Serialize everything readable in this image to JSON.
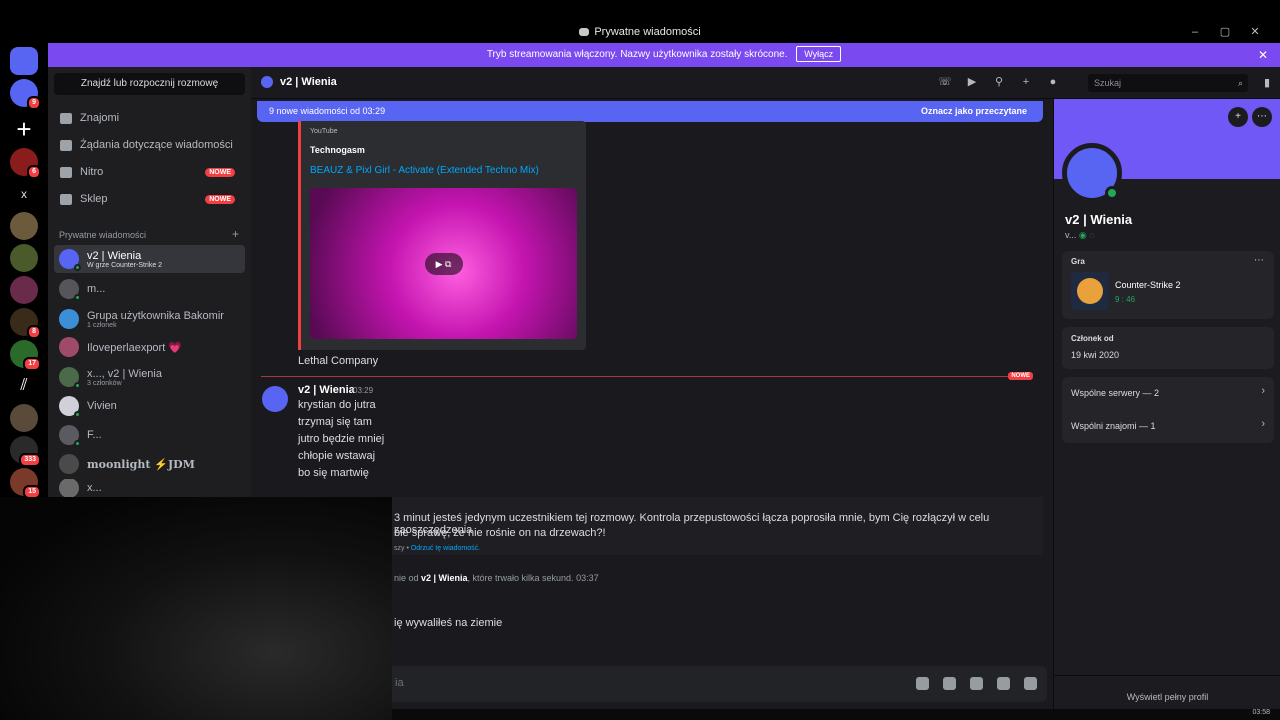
{
  "window": {
    "title": "Prywatne wiadomości",
    "controls": [
      "–",
      "▢",
      "✕"
    ]
  },
  "banner": {
    "text": "Tryb streamowania włączony. Nazwy użytkownika zostały skrócone.",
    "button": "Wyłącz",
    "close": "✕"
  },
  "rail": {
    "badges": [
      "9",
      "6",
      "8",
      "17",
      "333",
      "15"
    ],
    "x_label": "x"
  },
  "sidebar": {
    "search_placeholder": "Znajdź lub rozpocznij rozmowę",
    "nav": [
      {
        "label": "Znajomi"
      },
      {
        "label": "Żądania dotyczące wiadomości"
      },
      {
        "label": "Nitro",
        "badge": "NOWE"
      },
      {
        "label": "Sklep",
        "badge": "NOWE"
      }
    ],
    "section_label": "Prywatne wiadomości",
    "section_add": "+",
    "dms": [
      {
        "name": "v2 | Wienia",
        "sub": "W grze Counter-Strike 2",
        "active": true
      },
      {
        "name": "m...",
        "sub": ""
      },
      {
        "name": "Grupa użytkownika Bakomir",
        "sub": "1 członek"
      },
      {
        "name": "Iloveperlaexport 💗",
        "sub": ""
      },
      {
        "name": "x..., v2 | Wienia",
        "sub": "3 członków"
      },
      {
        "name": "Vivien",
        "sub": ""
      },
      {
        "name": "F...",
        "sub": ""
      },
      {
        "name": "moonlight ⚡JDM",
        "sub": ""
      },
      {
        "name": "x...",
        "sub": ""
      }
    ]
  },
  "header": {
    "title": "v2 | Wienia",
    "search_placeholder": "Szukaj"
  },
  "chat": {
    "new_messages": "9 nowe wiadomości od 03:29",
    "mark_read": "Oznacz jako przeczytane",
    "embed": {
      "source": "YouTube",
      "author": "Technogasm",
      "title": "BEAUZ & Pixl Girl - Activate (Extended Techno Mix)"
    },
    "prev_message": "Lethal Company",
    "divider_tag": "NOWE",
    "message": {
      "author": "v2 | Wienia",
      "time": "03:29",
      "lines": [
        "krystian do jutra",
        "trzymaj się tam",
        "jutro będzie mniej",
        "chłopie wstawaj",
        "bo się martwię"
      ]
    },
    "system": {
      "line1": "3 minut jesteś jedynym uczestnikiem tej rozmowy. Kontrola przepustowości łącza poprosiła mnie, bym Cię rozłączył w celu zaoszczędzenia",
      "line2": "bie sprawę, że nie rośnie on na drzewach?!",
      "meta_prefix": "szy • ",
      "meta_link": "Odrzuć tę wiadomość."
    },
    "call": {
      "prefix": "nie od ",
      "who": "v2 | Wienia",
      "suffix": ", które trwało kilka sekund.",
      "time": "03:37"
    },
    "last_message": "ię wywaliłeś na ziemie",
    "composer_placeholder": "ia"
  },
  "profile": {
    "name": "v2 | Wienia",
    "tag": "v...",
    "activity_label": "Gra",
    "game_name": "Counter-Strike 2",
    "game_time": "9 : 46",
    "member_since_label": "Członek od",
    "member_since": "19 kwi 2020",
    "mutual_servers": "Wspólne serwery — 2",
    "mutual_friends": "Wspólni znajomi — 1",
    "view_full": "Wyświetl pełny profil"
  },
  "taskbar": {
    "clock": "03:58"
  },
  "colors": {
    "brand": "#5865f2",
    "banner": "#7b49f0",
    "danger": "#f23f43",
    "online": "#23a55a"
  }
}
